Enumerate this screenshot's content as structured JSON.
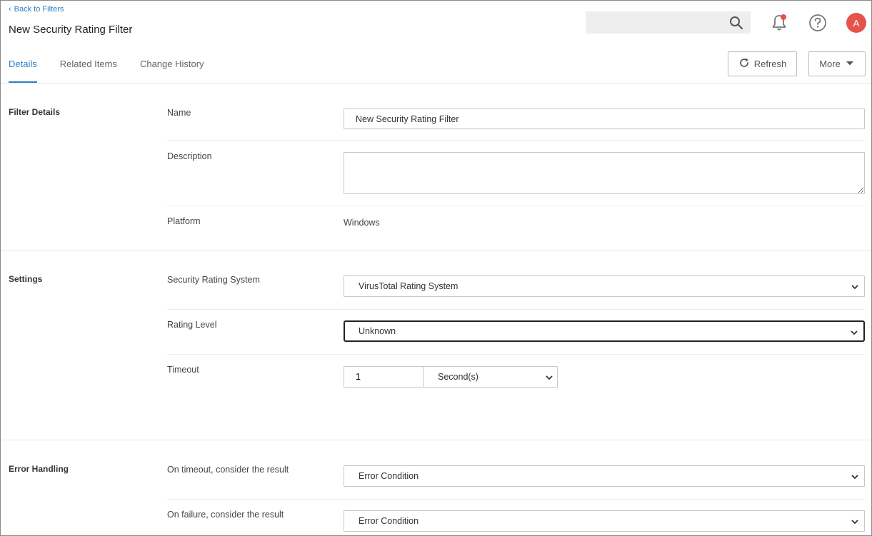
{
  "header": {
    "back_link": "Back to Filters",
    "title": "New Security Rating Filter",
    "search_placeholder": "",
    "avatar_initial": "A",
    "notification_dot_color": "#e5534b"
  },
  "tabs": [
    {
      "label": "Details",
      "active": true
    },
    {
      "label": "Related Items",
      "active": false
    },
    {
      "label": "Change History",
      "active": false
    }
  ],
  "toolbar": {
    "refresh_label": "Refresh",
    "more_label": "More"
  },
  "sections": {
    "filter_details": {
      "title": "Filter Details",
      "name_label": "Name",
      "name_value": "New Security Rating Filter",
      "description_label": "Description",
      "description_value": "",
      "platform_label": "Platform",
      "platform_value": "Windows"
    },
    "settings": {
      "title": "Settings",
      "rating_system_label": "Security Rating System",
      "rating_system_value": "VirusTotal Rating System",
      "rating_level_label": "Rating Level",
      "rating_level_value": "Unknown",
      "timeout_label": "Timeout",
      "timeout_value": "1",
      "timeout_unit": "Second(s)"
    },
    "error_handling": {
      "title": "Error Handling",
      "on_timeout_label": "On timeout, consider the result",
      "on_timeout_value": "Error Condition",
      "on_failure_label": "On failure, consider the result",
      "on_failure_value": "Error Condition"
    }
  },
  "colors": {
    "accent": "#2d7fc4",
    "avatar_bg": "#e5534b"
  }
}
